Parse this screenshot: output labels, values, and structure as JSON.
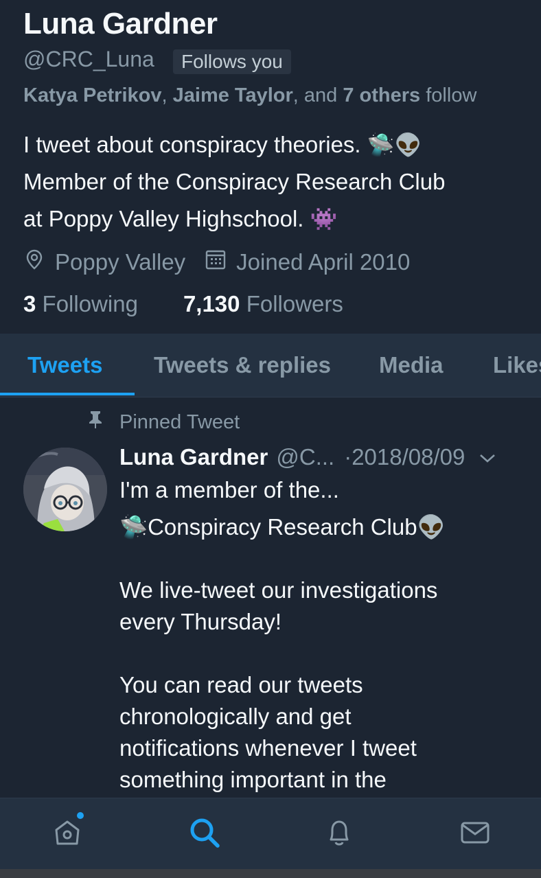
{
  "profile": {
    "name": "Luna Gardner",
    "handle": "@CRC_Luna",
    "follows_you": "Follows you",
    "followed_by": {
      "user1": "Katya Petrikov",
      "sep1": ", ",
      "user2": "Jaime Taylor",
      "sep2": ", and ",
      "others": "7 others",
      "suffix": " follow"
    },
    "bio": {
      "line1": "I tweet about conspiracy theories. ",
      "line1_emoji": "🛸👽",
      "line2": "Member of the Conspiracy Research Club",
      "line3": "at Poppy Valley Highschool. ",
      "line3_emoji": "👾"
    },
    "location_icon": "location-pin-icon",
    "location": "Poppy Valley",
    "joined_icon": "calendar-icon",
    "joined": "Joined April 2010",
    "following_count": "3",
    "following_label": "Following",
    "followers_count": "7,130",
    "followers_label": "Followers"
  },
  "tabs": [
    {
      "label": "Tweets",
      "active": true
    },
    {
      "label": "Tweets & replies",
      "active": false
    },
    {
      "label": "Media",
      "active": false
    },
    {
      "label": "Likes",
      "active": false
    }
  ],
  "pinned_tweet": {
    "pinned_icon": "pin-icon",
    "pinned_label": "Pinned Tweet",
    "author_name": "Luna Gardner",
    "author_handle": "@C...",
    "date": "·2018/08/09",
    "caret_icon": "chevron-down-icon",
    "body": [
      "I'm a member of the...",
      "🛸Conspiracy Research Club👽",
      "",
      "We live-tweet our investigations",
      "every Thursday!",
      "",
      "You can read our tweets",
      "chronologically and get",
      "notifications whenever I tweet",
      "something important in the"
    ]
  },
  "bottom_nav": [
    {
      "icon": "home-icon",
      "active": false,
      "has_badge": true
    },
    {
      "icon": "search-icon",
      "active": true
    },
    {
      "icon": "bell-icon",
      "active": false
    },
    {
      "icon": "mail-icon",
      "active": false
    }
  ],
  "colors": {
    "background": "#1c2532",
    "bar": "#243141",
    "accent": "#1da1f2",
    "muted": "#8899a6",
    "text": "#f5f8fa"
  }
}
